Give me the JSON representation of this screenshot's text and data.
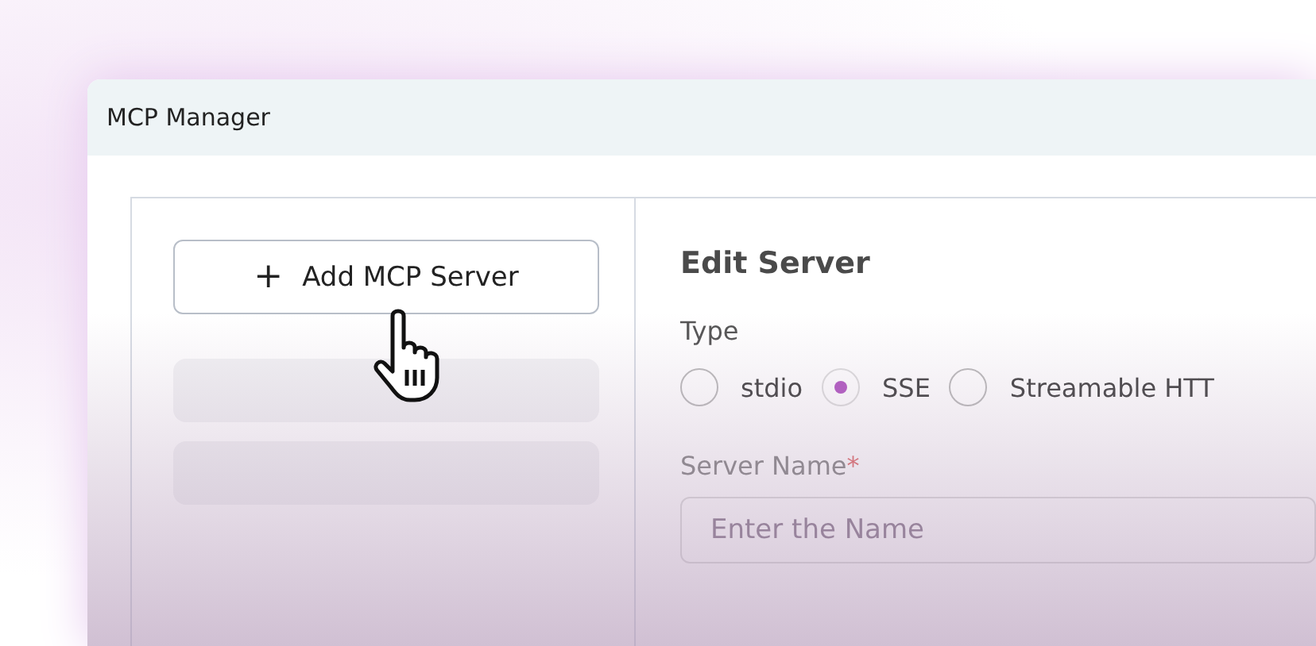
{
  "window": {
    "title": "MCP Manager"
  },
  "sidebar": {
    "add_button": {
      "icon": "+",
      "label": "Add MCP Server"
    },
    "rows": [
      {
        "kind": "skeleton"
      },
      {
        "kind": "skeleton"
      }
    ]
  },
  "editor": {
    "heading": "Edit Server",
    "type_label": "Type",
    "type_options": [
      {
        "label": "stdio",
        "selected": false
      },
      {
        "label": "SSE",
        "selected": true
      },
      {
        "label": "Streamable HTT",
        "selected": false
      }
    ],
    "name_field": {
      "label": "Server Name",
      "required_mark": "*",
      "placeholder": "Enter the Name"
    }
  }
}
